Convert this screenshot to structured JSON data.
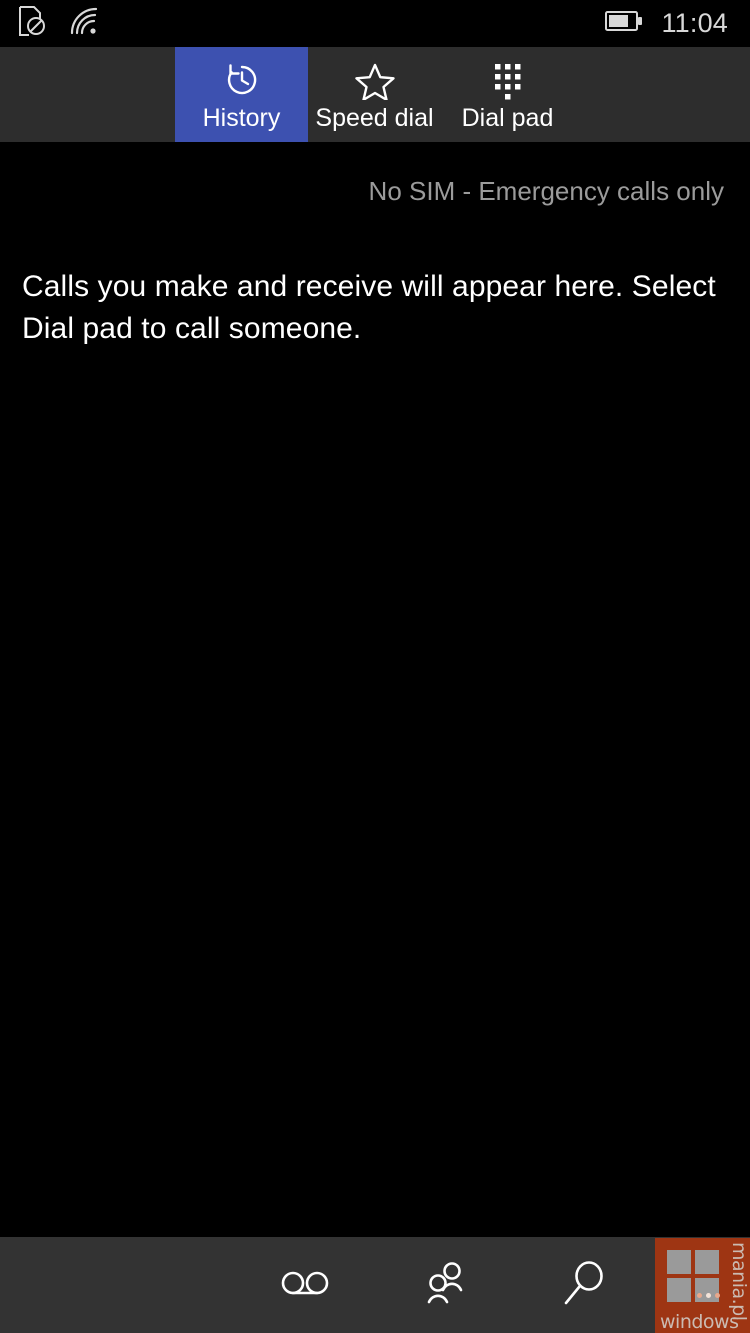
{
  "status_bar": {
    "icons": [
      {
        "name": "no-sim-icon",
        "label": "No SIM card"
      },
      {
        "name": "wifi-icon",
        "label": "Wi-Fi connected"
      },
      {
        "name": "battery-icon",
        "label": "Battery",
        "level_percent": 70
      }
    ],
    "clock": "11:04"
  },
  "tabs": [
    {
      "label": "History",
      "icon": "history-clock-icon",
      "active": true
    },
    {
      "label": "Speed dial",
      "icon": "star-icon",
      "active": false
    },
    {
      "label": "Dial pad",
      "icon": "dial-pad-icon",
      "active": false
    }
  ],
  "main": {
    "sim_status": "No SIM - Emergency calls only",
    "empty_message": "Calls you make and receive will appear here. Select Dial pad to call someone."
  },
  "app_bar": {
    "buttons": [
      {
        "label": "Voicemail",
        "icon": "voicemail-icon"
      },
      {
        "label": "Contacts",
        "icon": "contacts-people-icon"
      },
      {
        "label": "Search",
        "icon": "search-magnifier-icon"
      }
    ]
  },
  "watermark": {
    "brand": "windows",
    "domain": "mania.pl"
  },
  "colors": {
    "screen_background": "#000000",
    "tab_bar_background": "#2d2d2d",
    "active_tab_accent": "#3d51b0",
    "app_bar_background": "#333333",
    "primary_text": "#ffffff",
    "secondary_text": "#9b9b9b",
    "watermark_orange": "#9e3513"
  }
}
